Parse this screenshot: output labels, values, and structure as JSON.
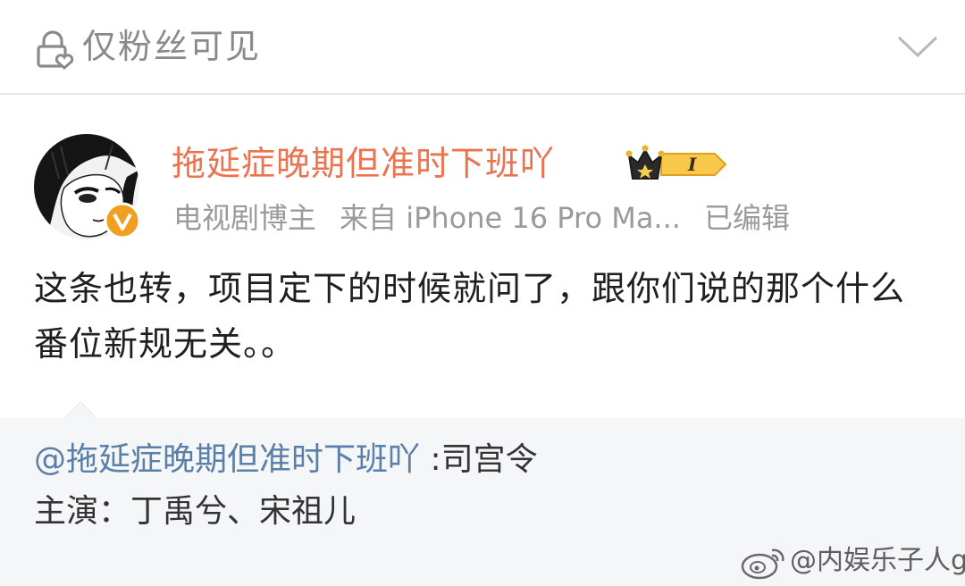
{
  "visibility": {
    "label": "仅粉丝可见"
  },
  "post": {
    "username": "拖延症晚期但准时下班吖",
    "vip_level": "I",
    "meta": {
      "tag": "电视剧博主",
      "source": "来自 iPhone 16 Pro Ma...",
      "edited": "已编辑"
    },
    "text": "这条也转，项目定下的时候就问了，跟你们说的那个什么番位新规无关。。"
  },
  "repost": {
    "mention": "@拖延症晚期但准时下班吖",
    "line1_rest": " :司宫令",
    "line2": "主演：丁禹兮、宋祖儿"
  },
  "watermark": {
    "text": "@内娱乐子人g"
  },
  "colors": {
    "username": "#eb7350",
    "mention": "#5a7fa8",
    "meta": "#9a9a9a",
    "badge": "#f0a020",
    "repost_bg": "#f5f6f7"
  }
}
